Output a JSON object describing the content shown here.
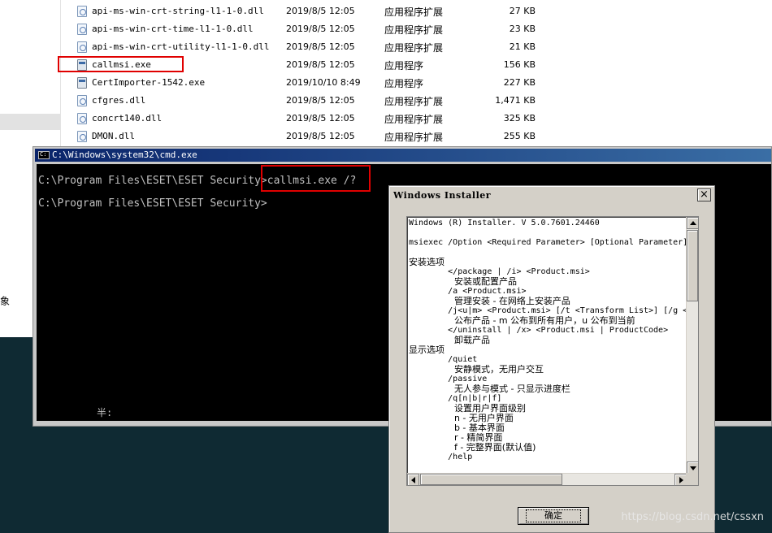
{
  "explorer": {
    "left_fragment": "象",
    "files": [
      {
        "name": "api-ms-win-crt-string-l1-1-0.dll",
        "date": "2019/8/5 12:05",
        "type": "应用程序扩展",
        "size": "27 KB",
        "icon": "dll-icon"
      },
      {
        "name": "api-ms-win-crt-time-l1-1-0.dll",
        "date": "2019/8/5 12:05",
        "type": "应用程序扩展",
        "size": "23 KB",
        "icon": "dll-icon"
      },
      {
        "name": "api-ms-win-crt-utility-l1-1-0.dll",
        "date": "2019/8/5 12:05",
        "type": "应用程序扩展",
        "size": "21 KB",
        "icon": "dll-icon"
      },
      {
        "name": "callmsi.exe",
        "date": "2019/8/5 12:05",
        "type": "应用程序",
        "size": "156 KB",
        "icon": "exe-icon"
      },
      {
        "name": "CertImporter-1542.exe",
        "date": "2019/10/10 8:49",
        "type": "应用程序",
        "size": "227 KB",
        "icon": "exe-icon"
      },
      {
        "name": "cfgres.dll",
        "date": "2019/8/5 12:05",
        "type": "应用程序扩展",
        "size": "1,471 KB",
        "icon": "dll-icon"
      },
      {
        "name": "concrt140.dll",
        "date": "2019/8/5 12:05",
        "type": "应用程序扩展",
        "size": "325 KB",
        "icon": "dll-icon"
      },
      {
        "name": "DMON.dll",
        "date": "2019/8/5 12:05",
        "type": "应用程序扩展",
        "size": "255 KB",
        "icon": "dll-icon"
      }
    ]
  },
  "cmd": {
    "title": "C:\\Windows\\system32\\cmd.exe",
    "line1_prompt": "C:\\Program Files\\ESET\\ESET Security>",
    "line1_command": "callmsi.exe /?",
    "line2_prompt": "C:\\Program Files\\ESET\\ESET Security>",
    "bottom_fragment": "半:"
  },
  "dialog": {
    "title": "Windows Installer",
    "close_glyph": "×",
    "ok_label": "确定",
    "help_lines": [
      "Windows (R) Installer. V 5.0.7601.24460",
      "",
      "msiexec /Option <Required Parameter> [Optional Parameter]",
      "",
      "安装选项",
      "        </package | /i> <Product.msi>",
      "                安装或配置产品",
      "        /a <Product.msi>",
      "                管理安装 - 在网络上安装产品",
      "        /j<u|m> <Product.msi> [/t <Transform List>] [/g <",
      "                公布产品 - m 公布到所有用户，u 公布到当前",
      "        </uninstall | /x> <Product.msi | ProductCode>",
      "                卸载产品",
      "显示选项",
      "        /quiet",
      "                安静模式，无用户交互",
      "        /passive",
      "                无人参与模式 - 只显示进度栏",
      "        /q[n|b|r|f]",
      "                设置用户界面级别",
      "                n - 无用户界面",
      "                b - 基本界面",
      "                r - 精简界面",
      "                f - 完整界面(默认值)",
      "        /help"
    ]
  },
  "watermark": "https://blog.csdn.net/cssxn",
  "colors": {
    "highlight_box": "#e00000",
    "desktop": "#0f2a33",
    "cmd_title": "#0a246a"
  }
}
